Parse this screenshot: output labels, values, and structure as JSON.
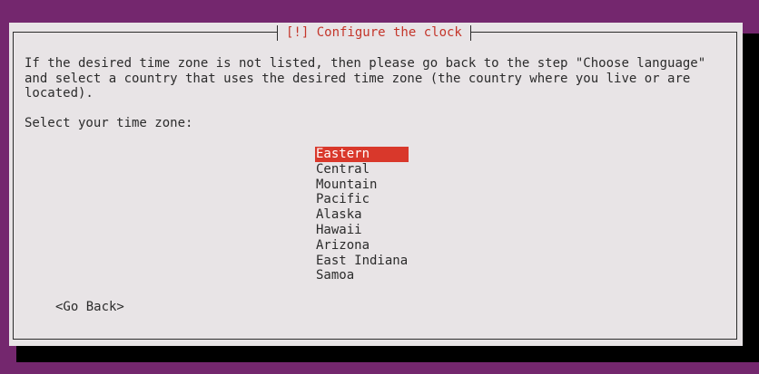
{
  "dialog": {
    "title": "[!] Configure the clock",
    "message_lines": [
      "If the desired time zone is not listed, then please go back to the step \"Choose language\"",
      "and select a country that uses the desired time zone (the country where you live or are",
      "located)."
    ],
    "prompt": "Select your time zone:",
    "timezones": [
      "Eastern",
      "Central",
      "Mountain",
      "Pacific",
      "Alaska",
      "Hawaii",
      "Arizona",
      "East Indiana",
      "Samoa"
    ],
    "selected_index": 0,
    "go_back_label": "<Go Back>"
  },
  "colors": {
    "background": "#74276e",
    "dialog_bg": "#e8e4e6",
    "title_text": "#c4352a",
    "selection_bg": "#d9382b",
    "selection_text": "#ffffff",
    "shadow": "#000000"
  }
}
